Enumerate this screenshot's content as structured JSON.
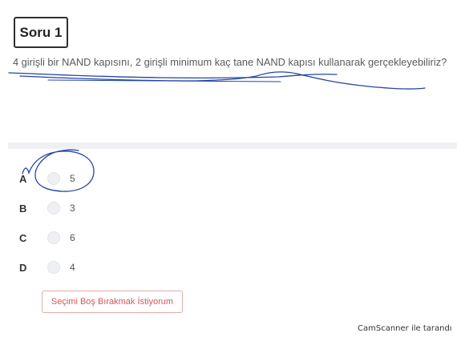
{
  "question": {
    "title": "Soru 1",
    "text": "4 girişli bir NAND kapısını, 2 girişli minimum kaç tane NAND kapısı kullanarak gerçekleyebiliriz?"
  },
  "options": [
    {
      "letter": "A",
      "value": "5"
    },
    {
      "letter": "B",
      "value": "3"
    },
    {
      "letter": "C",
      "value": "6"
    },
    {
      "letter": "D",
      "value": "4"
    }
  ],
  "clear_button": {
    "label": "Seçimi Boş Bırakmak İstiyorum"
  },
  "footer": {
    "text": "CamScanner ile tarandı"
  },
  "colors": {
    "annotation_ink": "#2345a8",
    "button_text": "#d05858",
    "button_border": "#e5aaaa",
    "radio_fill": "#eef0f4"
  }
}
